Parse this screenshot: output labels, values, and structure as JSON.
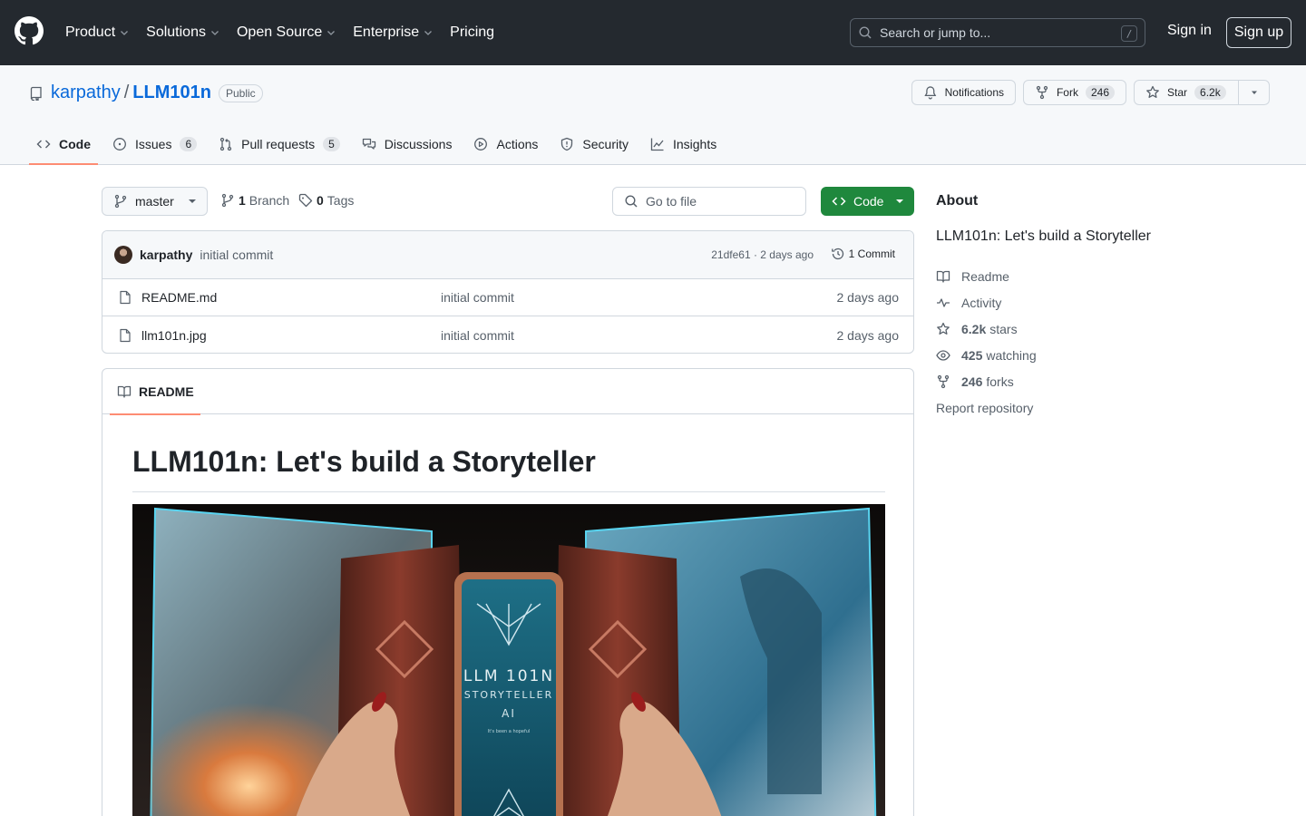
{
  "header": {
    "nav": [
      "Product",
      "Solutions",
      "Open Source",
      "Enterprise",
      "Pricing"
    ],
    "search_placeholder": "Search or jump to...",
    "search_shortcut": "/",
    "signin": "Sign in",
    "signup": "Sign up"
  },
  "repo": {
    "owner": "karpathy",
    "separator": "/",
    "name": "LLM101n",
    "visibility": "Public",
    "notifications_label": "Notifications",
    "fork_label": "Fork",
    "fork_count": "246",
    "star_label": "Star",
    "star_count": "6.2k",
    "tabs": [
      {
        "label": "Code",
        "count": ""
      },
      {
        "label": "Issues",
        "count": "6"
      },
      {
        "label": "Pull requests",
        "count": "5"
      },
      {
        "label": "Discussions",
        "count": ""
      },
      {
        "label": "Actions",
        "count": ""
      },
      {
        "label": "Security",
        "count": ""
      },
      {
        "label": "Insights",
        "count": ""
      }
    ]
  },
  "toolbar": {
    "branch": "master",
    "branch_count": "1",
    "branch_label": "Branch",
    "tag_count": "0",
    "tag_label": "Tags",
    "goto_file": "Go to file",
    "code_button": "Code"
  },
  "commit": {
    "author": "karpathy",
    "message": "initial commit",
    "meta": "21dfe61 · 2 days ago",
    "count_label": "1 Commit"
  },
  "files": [
    {
      "name": "README.md",
      "message": "initial commit",
      "date": "2 days ago"
    },
    {
      "name": "llm101n.jpg",
      "message": "initial commit",
      "date": "2 days ago"
    }
  ],
  "readme": {
    "tab_label": "README",
    "title": "LLM101n: Let's build a Storyteller",
    "image_text": {
      "line1": "LLM 101N",
      "line2": "STORYTELLER",
      "line3": "AI",
      "line4": "It's been a hopeful"
    }
  },
  "about": {
    "title": "About",
    "description": "LLM101n: Let's build a Storyteller",
    "readme": "Readme",
    "activity": "Activity",
    "stars_count": "6.2k",
    "stars_label": "stars",
    "watching_count": "425",
    "watching_label": "watching",
    "forks_count": "246",
    "forks_label": "forks",
    "report": "Report repository"
  },
  "colors": {
    "header_bg": "#24292f",
    "link": "#0969da",
    "code_button": "#1f883d",
    "tab_underline": "#fd8c73"
  }
}
